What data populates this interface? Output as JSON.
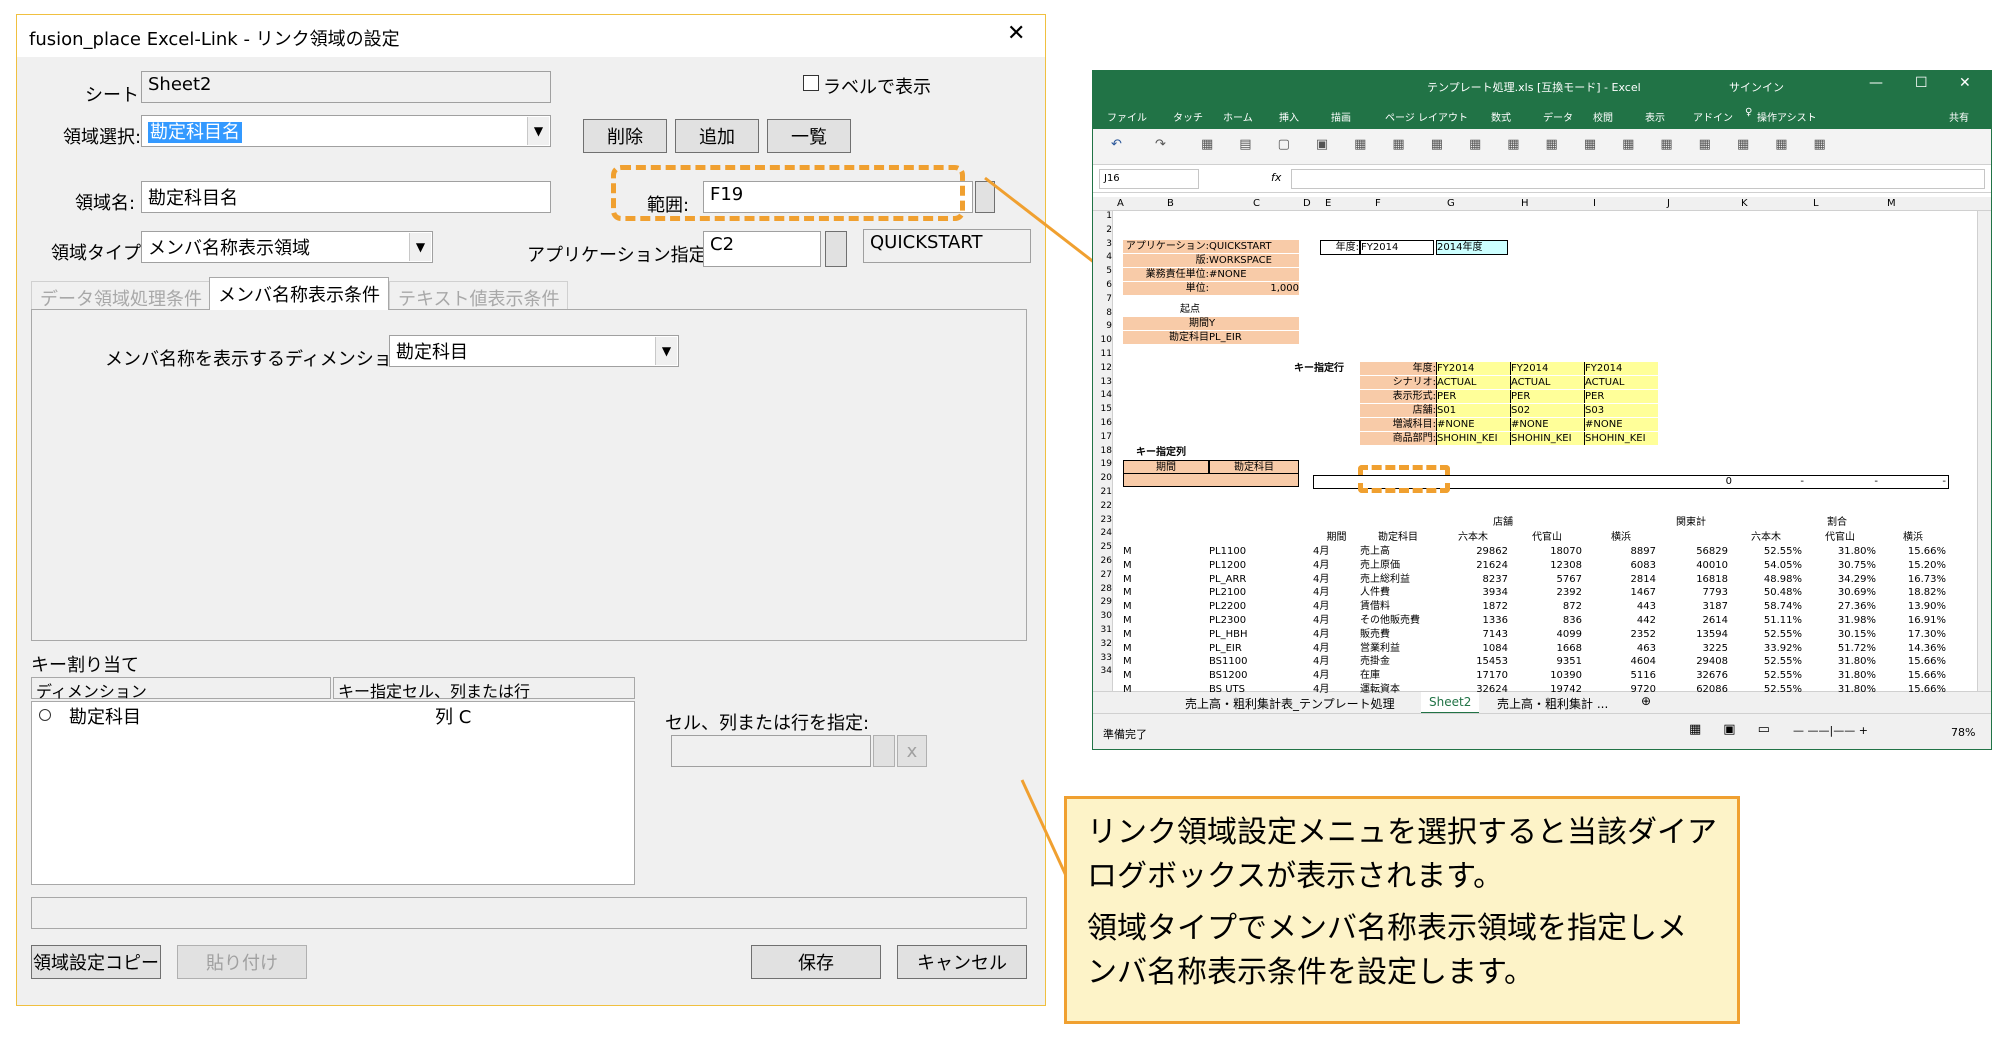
{
  "dialog": {
    "title": "fusion_place Excel-Link - リンク領域の設定",
    "close_glyph": "✕",
    "sheet_label": "シート:",
    "sheet_value": "Sheet2",
    "show_label_checkbox": "ラベルで表示",
    "area_select_label": "領域選択:",
    "area_select_value": "勘定科目名",
    "btn_delete": "削除",
    "btn_add": "追加",
    "btn_list": "一覧",
    "area_name_label": "領域名:",
    "area_name_value": "勘定科目名",
    "range_label": "範囲:",
    "range_value": "F19",
    "area_type_label": "領域タイプ:",
    "area_type_value": "メンバ名称表示領域",
    "app_cell_label": "アプリケーション指定セル:",
    "app_cell_value": "C2",
    "app_name_value": "QUICKSTART",
    "tabs": [
      "データ領域処理条件",
      "メンバ名称表示条件",
      "テキスト値表示条件"
    ],
    "dimension_label": "メンバ名称を表示するディメンション:",
    "dimension_value": "勘定科目",
    "key_assign_label": "キー割り当て",
    "key_col_dimension": "ディメンション",
    "key_col_cell": "キー指定セル、列または行",
    "key_row_dimension": "勘定科目",
    "key_row_cell": "列 C",
    "cell_spec_label": "セル、列または行を指定:",
    "clear_glyph": "x",
    "btn_copy": "領域設定コピー",
    "btn_paste": "貼り付け",
    "btn_save": "保存",
    "btn_cancel": "キャンセル"
  },
  "excel": {
    "title": "テンプレート処理.xls [互換モード] - Excel",
    "signin": "サインイン",
    "ribbon_tabs": [
      "ファイル",
      "タッチ",
      "ホーム",
      "挿入",
      "描画",
      "ページ レイアウト",
      "数式",
      "データ",
      "校閲",
      "表示",
      "アドイン"
    ],
    "assist": "操作アシスト",
    "share": "共有",
    "name_box": "J16",
    "fx": "fx",
    "col_headers": [
      "A",
      "B",
      "C",
      "D",
      "E",
      "F",
      "G",
      "H",
      "I",
      "J",
      "K",
      "L",
      "M"
    ],
    "row_numbers": [
      "1",
      "2",
      "3",
      "4",
      "5",
      "6",
      "7",
      "8",
      "9",
      "10",
      "11",
      "12",
      "13",
      "14",
      "15",
      "16",
      "17",
      "18",
      "19",
      "20",
      "21",
      "22",
      "23",
      "24",
      "25",
      "26",
      "27",
      "28",
      "29",
      "30",
      "31",
      "32",
      "33",
      "34"
    ],
    "params": [
      {
        "label": "アプリケーション:",
        "value": "QUICKSTART"
      },
      {
        "label": "版:",
        "value": "WORKSPACE"
      },
      {
        "label": "業務責任単位:",
        "value": "#NONE"
      },
      {
        "label": "単位:",
        "value": "1,000"
      }
    ],
    "year_label": "年度:",
    "year_value": "FY2014",
    "year_text": "2014年度",
    "origin_label": "起点",
    "origin_rows": [
      {
        "label": "期間",
        "value": "Y"
      },
      {
        "label": "勘定科目",
        "value": "PL_EIR"
      }
    ],
    "key_row_title": "キー指定行",
    "key_rows": [
      {
        "label": "年度:",
        "values": [
          "FY2014",
          "FY2014",
          "FY2014"
        ]
      },
      {
        "label": "シナリオ:",
        "values": [
          "ACTUAL",
          "ACTUAL",
          "ACTUAL"
        ]
      },
      {
        "label": "表示形式:",
        "values": [
          "PER",
          "PER",
          "PER"
        ]
      },
      {
        "label": "店舗:",
        "values": [
          "S01",
          "S02",
          "S03"
        ]
      },
      {
        "label": "増減科目:",
        "values": [
          "#NONE",
          "#NONE",
          "#NONE"
        ]
      },
      {
        "label": "商品部門:",
        "values": [
          "SHOHIN_KEI",
          "SHOHIN_KEI",
          "SHOHIN_KEI"
        ]
      }
    ],
    "key_col_title": "キー指定列",
    "key_col_headers": [
      "期間",
      "勘定科目"
    ],
    "row19_values": [
      "0",
      "-",
      "-",
      "-"
    ],
    "group_headers": [
      "店舗",
      "関東計",
      "割合"
    ],
    "sub_headers": [
      "期間",
      "勘定科目",
      "六本木",
      "代官山",
      "横浜",
      "六本木",
      "代官山",
      "横浜"
    ],
    "data_rows": [
      [
        "M",
        "PL1100",
        "4月",
        "売上高",
        "29862",
        "18070",
        "8897",
        "56829",
        "52.55%",
        "31.80%",
        "15.66%"
      ],
      [
        "M",
        "PL1200",
        "4月",
        "売上原価",
        "21624",
        "12308",
        "6083",
        "40010",
        "54.05%",
        "30.75%",
        "15.20%"
      ],
      [
        "M",
        "PL_ARR",
        "4月",
        "売上総利益",
        "8237",
        "5767",
        "2814",
        "16818",
        "48.98%",
        "34.29%",
        "16.73%"
      ],
      [
        "M",
        "PL2100",
        "4月",
        "人件費",
        "3934",
        "2392",
        "1467",
        "7793",
        "50.48%",
        "30.69%",
        "18.82%"
      ],
      [
        "M",
        "PL2200",
        "4月",
        "賃借料",
        "1872",
        "872",
        "443",
        "3187",
        "58.74%",
        "27.36%",
        "13.90%"
      ],
      [
        "M",
        "PL2300",
        "4月",
        "その他販売費",
        "1336",
        "836",
        "442",
        "2614",
        "51.11%",
        "31.98%",
        "16.91%"
      ],
      [
        "M",
        "PL_HBH",
        "4月",
        "販売費",
        "7143",
        "4099",
        "2352",
        "13594",
        "52.55%",
        "30.15%",
        "17.30%"
      ],
      [
        "M",
        "PL_EIR",
        "4月",
        "営業利益",
        "1084",
        "1668",
        "463",
        "3225",
        "33.92%",
        "51.72%",
        "14.36%"
      ],
      [
        "M",
        "BS1100",
        "4月",
        "売掛金",
        "15453",
        "9351",
        "4604",
        "29408",
        "52.55%",
        "31.80%",
        "15.66%"
      ],
      [
        "M",
        "BS1200",
        "4月",
        "在庫",
        "17170",
        "10390",
        "5116",
        "32676",
        "52.55%",
        "31.80%",
        "15.66%"
      ],
      [
        "M",
        "BS UTS",
        "4月",
        "運転資本",
        "32624",
        "19742",
        "9720",
        "62086",
        "52.55%",
        "31.80%",
        "15.66%"
      ]
    ],
    "sheet_tabs": [
      "売上高・粗利集計表_テンプレート処理",
      "Sheet2",
      "売上高・粗利集計 ..."
    ],
    "status": "準備完了",
    "zoom": "78%"
  },
  "callout": {
    "line1": "リンク領域設定メニュを選択すると当該ダイア",
    "line2": "ログボックスが表示されます。",
    "line3": "領域タイプでメンバ名称表示領域を指定しメ",
    "line4": "ンバ名称表示条件を設定します。"
  },
  "colors": {
    "excel_green": "#217346",
    "highlight_orange": "#f0a030",
    "callout_bg": "#fdf3c8",
    "orange_cell": "#f8cba8",
    "yellow_cell": "#ffff99"
  }
}
